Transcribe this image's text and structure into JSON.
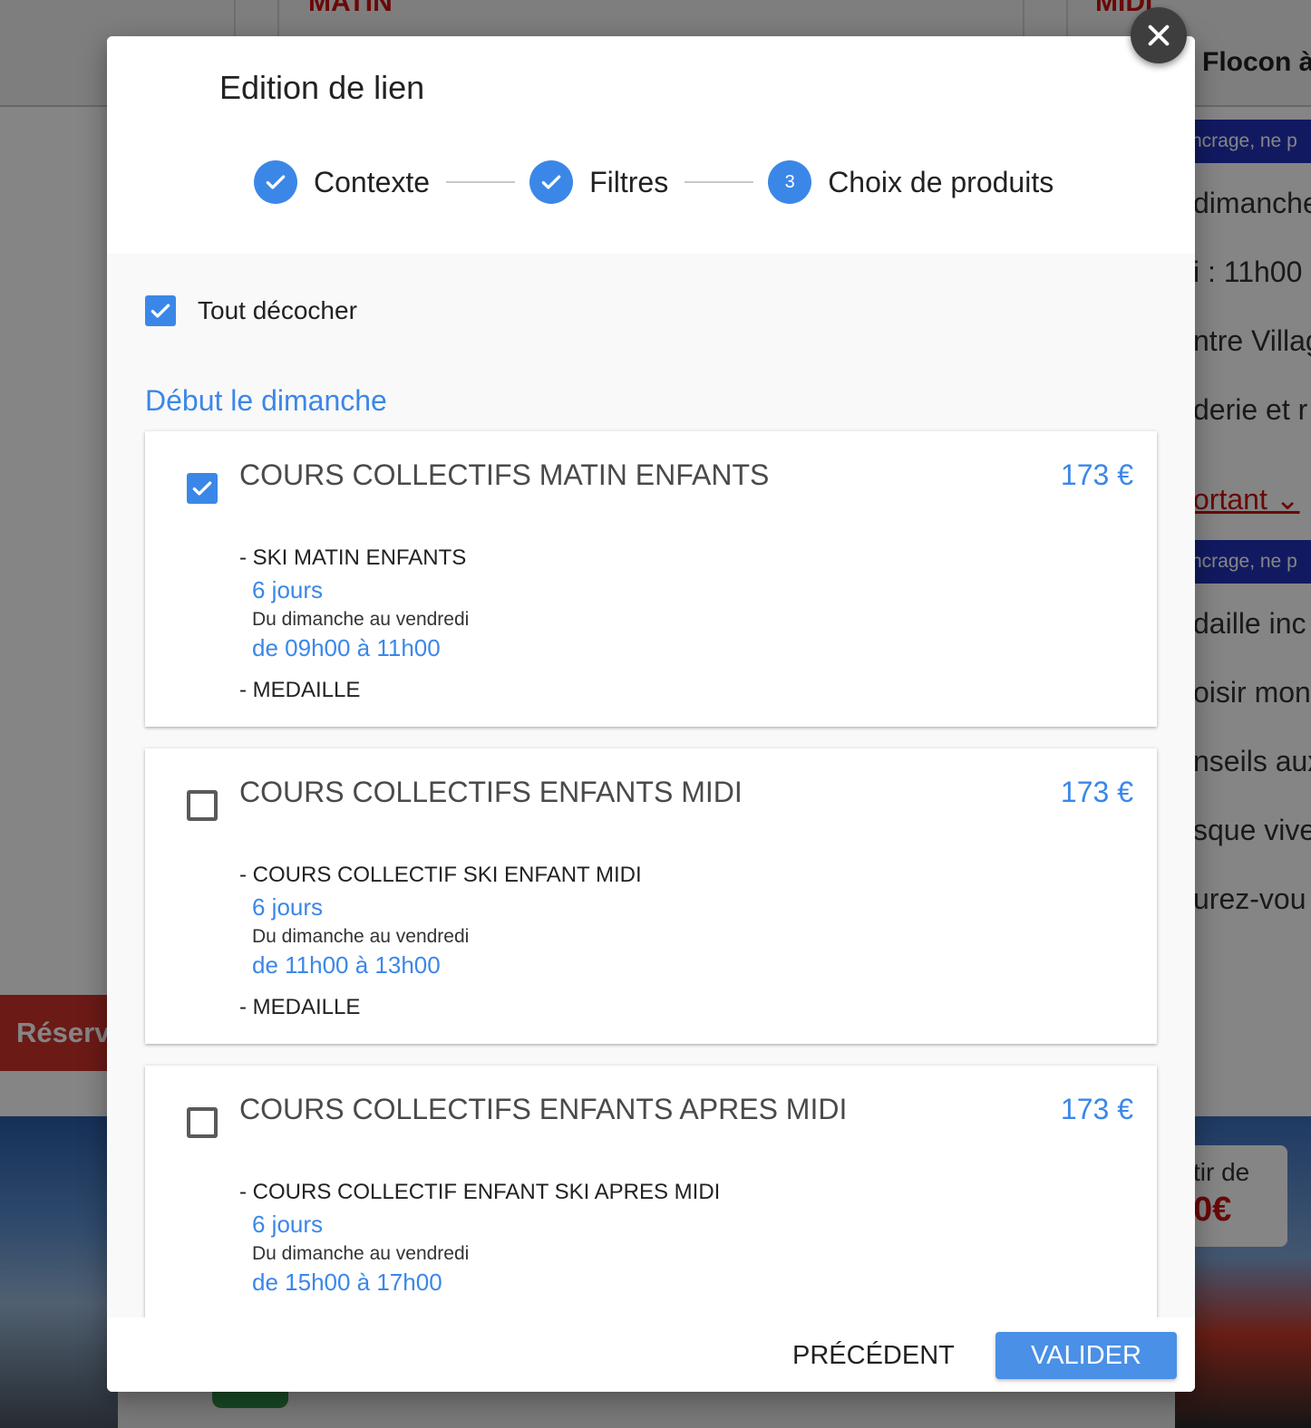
{
  "background": {
    "headings": [
      "MATIN",
      "MIDI"
    ],
    "title": "Flocon à",
    "pills": [
      "ncrage, ne p",
      "ncrage, ne p"
    ],
    "lines": [
      "dimanche",
      "i : 11h00",
      "ntre Villag",
      "derie et r",
      "daille inc",
      "oisir mon",
      "nseils aux",
      "sque vive",
      "urez-vou"
    ],
    "link": "ortant ⌄",
    "reserve_button": "Réserv",
    "price_from": "tir de",
    "price_value": "0€"
  },
  "modal": {
    "title": "Edition de lien",
    "close_icon": "close-icon",
    "steps": [
      {
        "label": "Contexte",
        "state": "done"
      },
      {
        "label": "Filtres",
        "state": "done"
      },
      {
        "label": "Choix de produits",
        "state": "active",
        "number": "3"
      }
    ],
    "uncheck_all_label": "Tout décocher",
    "section_title": "Début le dimanche",
    "products": [
      {
        "title": "COURS COLLECTIFS MATIN ENFANTS",
        "price": "173 €",
        "checked": true,
        "item": "- SKI MATIN ENFANTS",
        "duration": "6 jours",
        "days": "Du dimanche au vendredi",
        "hours": "de 09h00 à 11h00",
        "extra": "- MEDAILLE"
      },
      {
        "title": "COURS COLLECTIFS ENFANTS MIDI",
        "price": "173 €",
        "checked": false,
        "item": "- COURS COLLECTIF SKI ENFANT MIDI",
        "duration": "6 jours",
        "days": "Du dimanche au vendredi",
        "hours": "de 11h00 à 13h00",
        "extra": "- MEDAILLE"
      },
      {
        "title": "COURS COLLECTIFS ENFANTS APRES MIDI",
        "price": "173 €",
        "checked": false,
        "item": "- COURS COLLECTIF ENFANT SKI APRES MIDI",
        "duration": "6 jours",
        "days": "Du dimanche au vendredi",
        "hours": "de 15h00 à 17h00"
      }
    ],
    "footer": {
      "previous_label": "PRÉCÉDENT",
      "validate_label": "VALIDER"
    }
  },
  "colors": {
    "accent": "#3b87e8",
    "button": "#4a90e6",
    "brand_red": "#cc1111",
    "overlay": "rgba(0,0,0,0.48)"
  }
}
